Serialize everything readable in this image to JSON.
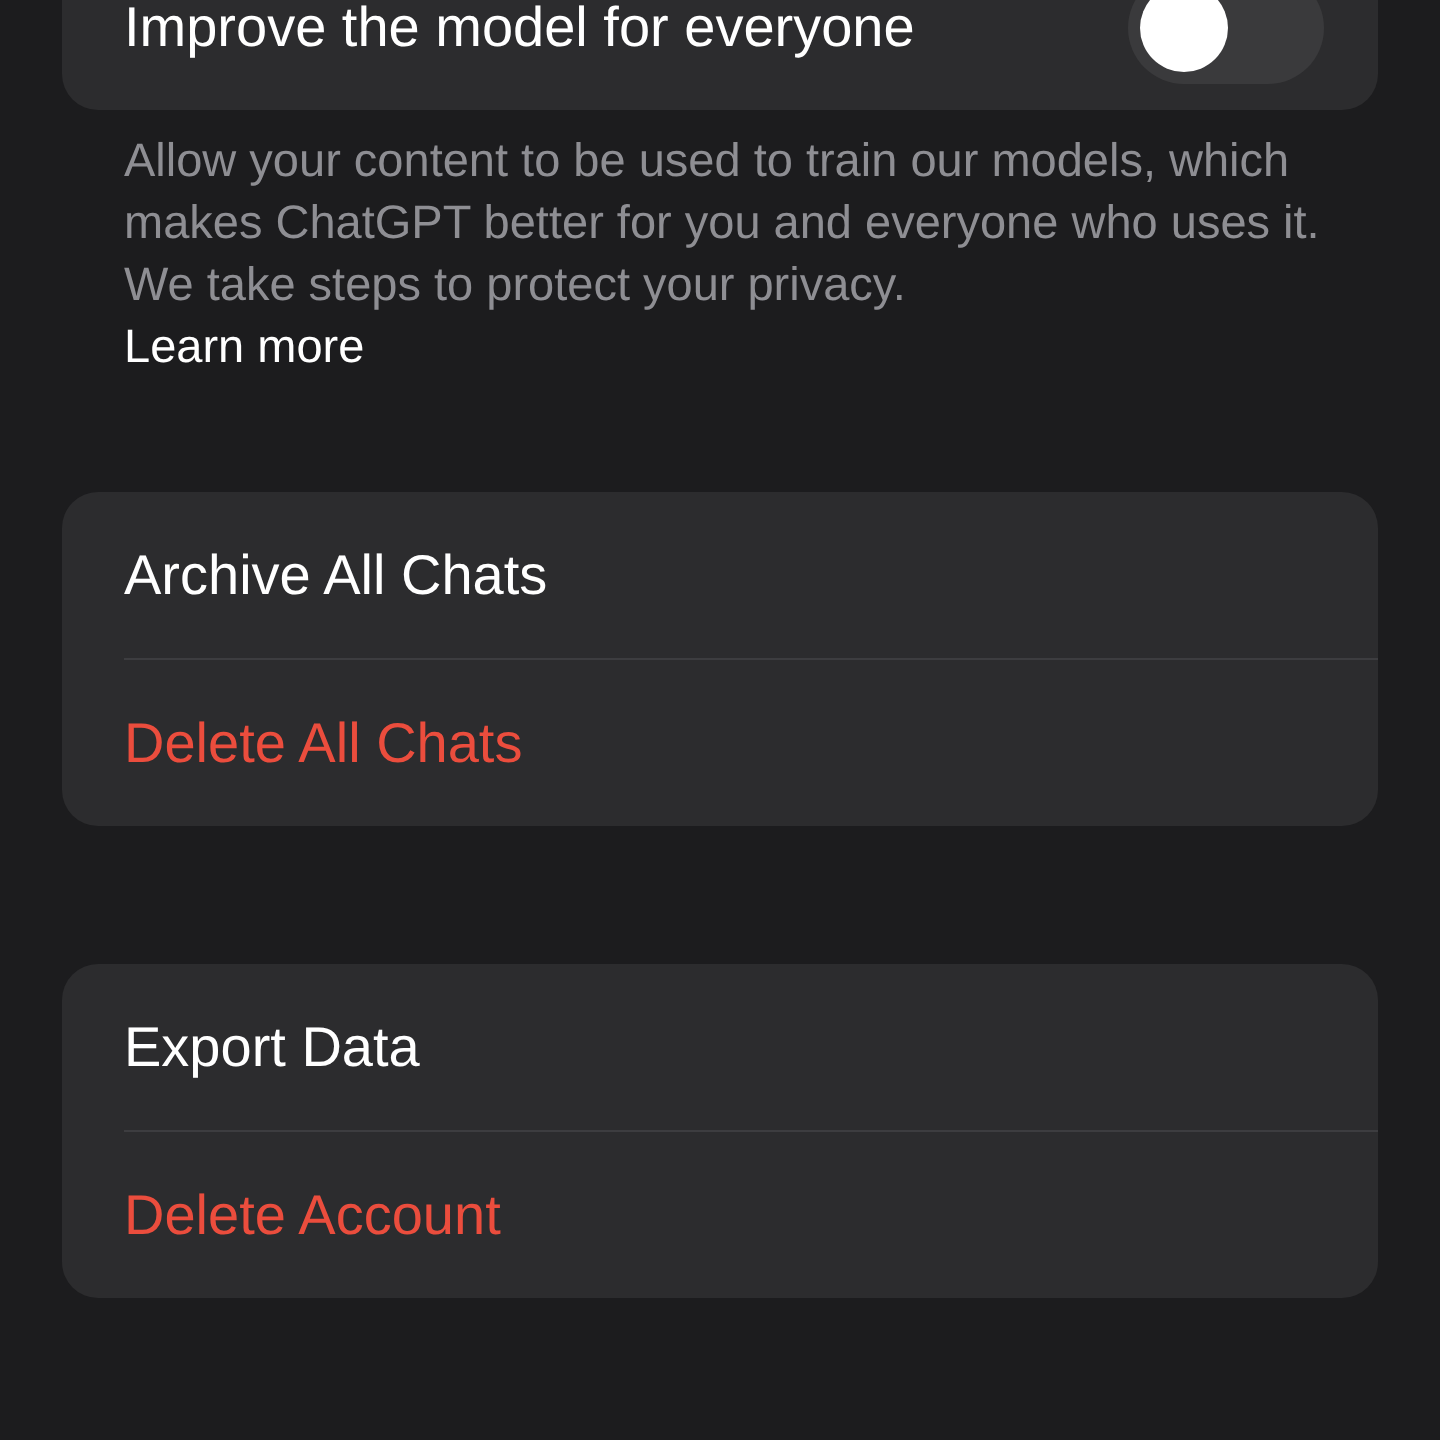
{
  "improve_setting": {
    "label": "Improve the model for everyone",
    "on": false
  },
  "description": {
    "text": "Allow your content to be used to train our models, which makes ChatGPT better for you and everyone who uses it. We take steps to protect your privacy.",
    "link": "Learn more"
  },
  "groups": [
    {
      "items": [
        {
          "label": "Archive All Chats",
          "kind": "normal"
        },
        {
          "label": "Delete All Chats",
          "kind": "destructive"
        }
      ]
    },
    {
      "items": [
        {
          "label": "Export Data",
          "kind": "normal"
        },
        {
          "label": "Delete Account",
          "kind": "destructive"
        }
      ]
    }
  ]
}
